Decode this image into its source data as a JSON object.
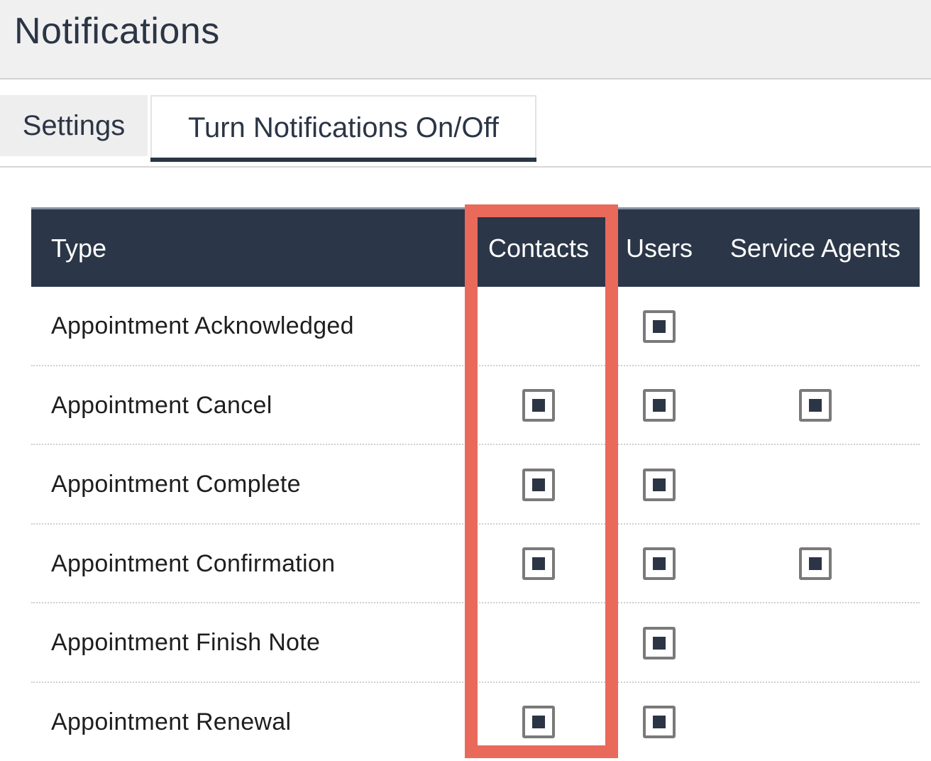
{
  "header": {
    "title": "Notifications"
  },
  "tabs": [
    {
      "label": "Settings",
      "active": false
    },
    {
      "label": "Turn Notifications On/Off",
      "active": true
    }
  ],
  "table": {
    "columns": {
      "type": "Type",
      "contacts": "Contacts",
      "users": "Users",
      "agents": "Service Agents"
    },
    "rows": [
      {
        "label": "Appointment Acknowledged",
        "contacts": false,
        "users": true,
        "agents": false
      },
      {
        "label": "Appointment Cancel",
        "contacts": true,
        "users": true,
        "agents": true
      },
      {
        "label": "Appointment Complete",
        "contacts": true,
        "users": true,
        "agents": false
      },
      {
        "label": "Appointment Confirmation",
        "contacts": true,
        "users": true,
        "agents": true
      },
      {
        "label": "Appointment Finish Note",
        "contacts": false,
        "users": true,
        "agents": false
      },
      {
        "label": "Appointment Renewal",
        "contacts": true,
        "users": true,
        "agents": false
      }
    ]
  },
  "colors": {
    "header_bg": "#2b3748",
    "highlight": "#e9695b",
    "checkbox_mark": "#2b3545"
  }
}
